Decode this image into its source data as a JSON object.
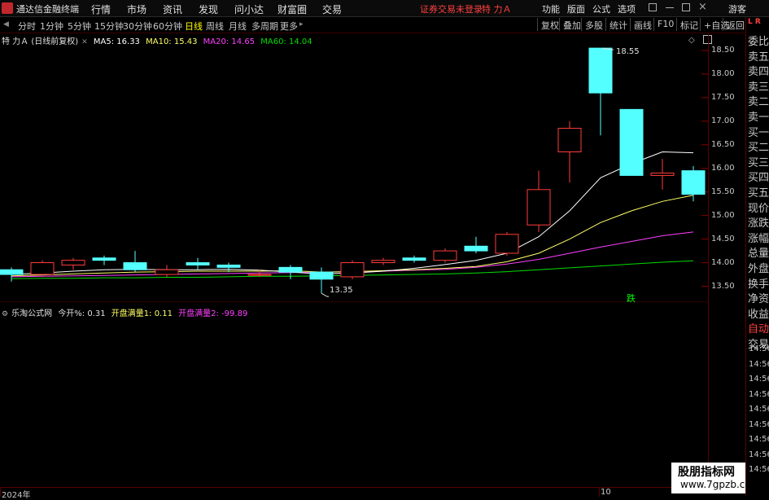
{
  "menubar": {
    "app_title": "通达信金融终端",
    "menu": [
      "行情",
      "市场",
      "资讯",
      "发现",
      "问小达",
      "财富圈",
      "交易"
    ],
    "login_warning": "证券交易未登录",
    "stock_name": "特 力Ａ",
    "right_menu": [
      "功能",
      "版面",
      "公式",
      "选项"
    ],
    "guest": "游客"
  },
  "toolbar": {
    "periods": [
      "分时",
      "1分钟",
      "5分钟",
      "15分钟",
      "30分钟",
      "60分钟",
      "日线",
      "周线",
      "月线",
      "多周期",
      "更多"
    ],
    "active_period": "日线",
    "buttons": [
      "复权",
      "叠加",
      "多股",
      "统计",
      "画线",
      "F10",
      "标记",
      "+自选",
      "返回"
    ]
  },
  "chart_header": {
    "title": "特 力Ａ (日线前复权)",
    "ma5": "MA5: 16.33",
    "ma10": "MA10: 15.43",
    "ma20": "MA20: 14.65",
    "ma60": "MA60: 14.04"
  },
  "indicator": {
    "name": "乐淘公式网",
    "today_open": "今开%: 0.31",
    "kaipan1": "开盘满量1: 0.11",
    "kaipan2": "开盘满量2: -99.89"
  },
  "annotations": {
    "high": "18.55",
    "low": "13.35",
    "die": "跌"
  },
  "bottom": {
    "year": "2024年",
    "month": "10"
  },
  "right_panel": {
    "top_label": "L R",
    "items": [
      "委比",
      "卖五",
      "卖四",
      "卖三",
      "卖二",
      "卖一",
      "买一",
      "买二",
      "买三",
      "买四",
      "买五",
      "现价",
      "涨跌",
      "涨幅",
      "总量",
      "外盘",
      "换手",
      "净资",
      "收益",
      "自动",
      "交易"
    ],
    "times": [
      "14:56",
      "14:56",
      "14:56",
      "14:56",
      "14:56",
      "14:56",
      "14:56",
      "14:56",
      "14:56"
    ]
  },
  "watermark": {
    "line1": "股朋指标网",
    "line2": "www.7gpzb.com"
  },
  "colors": {
    "up": "#ff3c3c",
    "down": "#54ffff",
    "ma5": "#ffffff",
    "ma10": "#ffff66",
    "ma20": "#ff40ff",
    "ma60": "#00dd00"
  },
  "chart_data": {
    "type": "candlestick",
    "title": "特 力Ａ (日线前复权)",
    "yticks": [
      "18.50",
      "18.00",
      "17.50",
      "17.00",
      "16.50",
      "16.00",
      "15.50",
      "15.00",
      "14.50",
      "14.00",
      "13.50"
    ],
    "ylim": [
      13.3,
      18.8
    ],
    "candles": [
      {
        "o": 13.85,
        "c": 13.75,
        "h": 13.9,
        "l": 13.6
      },
      {
        "o": 13.75,
        "c": 14.0,
        "h": 14.05,
        "l": 13.7
      },
      {
        "o": 13.95,
        "c": 14.05,
        "h": 14.1,
        "l": 13.85
      },
      {
        "o": 14.1,
        "c": 14.05,
        "h": 14.15,
        "l": 13.95
      },
      {
        "o": 14.0,
        "c": 13.85,
        "h": 14.25,
        "l": 13.8
      },
      {
        "o": 13.75,
        "c": 13.85,
        "h": 13.95,
        "l": 13.7
      },
      {
        "o": 14.0,
        "c": 13.95,
        "h": 14.1,
        "l": 13.85
      },
      {
        "o": 13.95,
        "c": 13.9,
        "h": 14.0,
        "l": 13.8
      },
      {
        "o": 13.75,
        "c": 13.75,
        "h": 13.85,
        "l": 13.7
      },
      {
        "o": 13.9,
        "c": 13.8,
        "h": 13.95,
        "l": 13.65
      },
      {
        "o": 13.8,
        "c": 13.65,
        "h": 13.9,
        "l": 13.35
      },
      {
        "o": 13.7,
        "c": 14.0,
        "h": 14.05,
        "l": 13.65
      },
      {
        "o": 14.0,
        "c": 14.05,
        "h": 14.1,
        "l": 13.95
      },
      {
        "o": 14.1,
        "c": 14.05,
        "h": 14.15,
        "l": 14.0
      },
      {
        "o": 14.05,
        "c": 14.25,
        "h": 14.3,
        "l": 14.0
      },
      {
        "o": 14.35,
        "c": 14.25,
        "h": 14.55,
        "l": 14.2
      },
      {
        "o": 14.2,
        "c": 14.6,
        "h": 14.65,
        "l": 14.15
      },
      {
        "o": 14.8,
        "c": 15.55,
        "h": 15.95,
        "l": 14.65
      },
      {
        "o": 16.35,
        "c": 16.85,
        "h": 17.0,
        "l": 15.7
      },
      {
        "o": 18.55,
        "c": 17.6,
        "h": 18.55,
        "l": 16.7
      },
      {
        "o": 17.25,
        "c": 15.85,
        "h": 17.25,
        "l": 15.85
      },
      {
        "o": 15.85,
        "c": 15.9,
        "h": 16.2,
        "l": 15.55
      },
      {
        "o": 15.95,
        "c": 15.45,
        "h": 16.05,
        "l": 15.3
      }
    ],
    "ma5": [
      13.75,
      13.78,
      13.82,
      13.85,
      13.86,
      13.85,
      13.85,
      13.86,
      13.84,
      13.8,
      13.76,
      13.78,
      13.82,
      13.88,
      13.96,
      14.05,
      14.2,
      14.55,
      15.1,
      15.8,
      16.1,
      16.35,
      16.33
    ],
    "ma10": [
      13.72,
      13.74,
      13.76,
      13.78,
      13.8,
      13.81,
      13.82,
      13.82,
      13.82,
      13.83,
      13.8,
      13.81,
      13.83,
      13.85,
      13.88,
      13.92,
      14.02,
      14.2,
      14.5,
      14.85,
      15.1,
      15.3,
      15.43
    ],
    "ma20": [
      13.7,
      13.71,
      13.72,
      13.73,
      13.74,
      13.75,
      13.76,
      13.77,
      13.78,
      13.79,
      13.8,
      13.81,
      13.82,
      13.84,
      13.86,
      13.9,
      13.97,
      14.07,
      14.2,
      14.33,
      14.45,
      14.57,
      14.65
    ],
    "ma60": [
      13.66,
      13.67,
      13.67,
      13.68,
      13.68,
      13.69,
      13.69,
      13.7,
      13.71,
      13.71,
      13.72,
      13.73,
      13.74,
      13.75,
      13.76,
      13.78,
      13.81,
      13.85,
      13.89,
      13.93,
      13.97,
      14.01,
      14.04
    ]
  }
}
